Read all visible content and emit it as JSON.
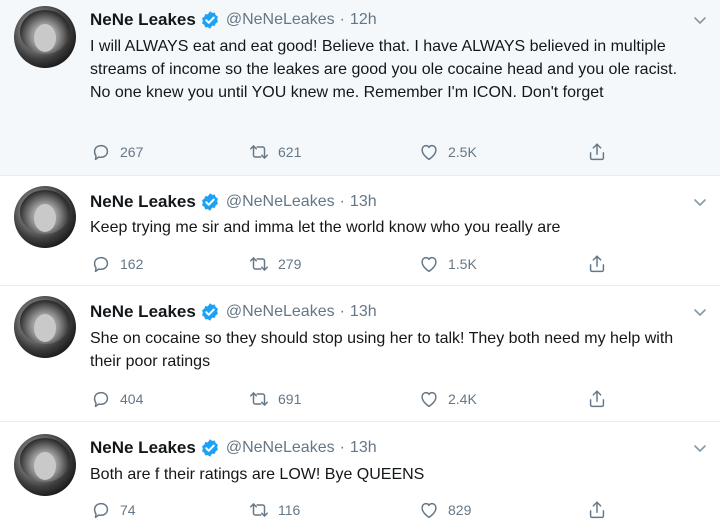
{
  "tweets": [
    {
      "name": "NeNe Leakes",
      "handle": "@NeNeLeakes",
      "separator": "·",
      "time": "12h",
      "text": "I will ALWAYS eat and eat good! Believe that. I have ALWAYS believed in multiple streams of income so the leakes are good you ole cocaine head and you ole racist. No one knew you until YOU knew me. Remember I'm ICON. Don't forget",
      "replies": "267",
      "retweets": "621",
      "likes": "2.5K"
    },
    {
      "name": "NeNe Leakes",
      "handle": "@NeNeLeakes",
      "separator": "·",
      "time": "13h",
      "text": "Keep trying me sir and imma let the world know who you really are",
      "replies": "162",
      "retweets": "279",
      "likes": "1.5K"
    },
    {
      "name": "NeNe Leakes",
      "handle": "@NeNeLeakes",
      "separator": "·",
      "time": "13h",
      "text": "She on cocaine so they should stop using her to talk! They both need my help with their poor ratings",
      "replies": "404",
      "retweets": "691",
      "likes": "2.4K"
    },
    {
      "name": "NeNe Leakes",
      "handle": "@NeNeLeakes",
      "separator": "·",
      "time": "13h",
      "text": "Both are f their ratings are LOW! Bye QUEENS",
      "replies": "74",
      "retweets": "116",
      "likes": "829"
    }
  ],
  "colors": {
    "verified": "#1da1f2",
    "secondary_text": "#657786",
    "primary_text": "#14171a",
    "highlight_bg": "#f5f8fa"
  },
  "icons": [
    "verified-badge-icon",
    "chevron-down-icon",
    "reply-icon",
    "retweet-icon",
    "like-icon",
    "share-icon"
  ]
}
